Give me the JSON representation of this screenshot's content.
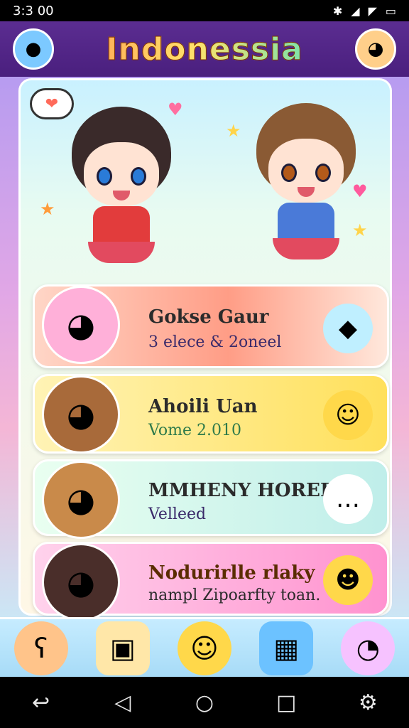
{
  "status_bar": {
    "time": "3:3 00",
    "icons": [
      "bluetooth-icon",
      "wifi-icon",
      "signal-icon",
      "battery-icon"
    ]
  },
  "header": {
    "title": "Indonessia",
    "left_avatar_icon": "blue-creature-avatar-icon",
    "right_avatar_icon": "cat-avatar-icon"
  },
  "hero": {
    "characters": [
      "girl-red-dress-icon",
      "girl-blue-dress-icon"
    ],
    "bubble_icon": "heart-speech-bubble-icon"
  },
  "cards": [
    {
      "title": "Gokse Gaur",
      "subtitle": "3 elece & 2oneel",
      "avatar_icon": "pink-hair-girl-icon",
      "action_icon": "blue-bird-mascot-icon",
      "colors": {
        "start": "#ffd6c7",
        "end": "#ff9d86"
      }
    },
    {
      "title": "Ahoili Uan",
      "subtitle": "Vome 2.010",
      "avatar_icon": "brown-hair-girl-icon",
      "action_icon": "yellow-cat-mascot-icon",
      "colors": {
        "start": "#fff3b5",
        "end": "#ffe05b"
      }
    },
    {
      "title": "MMHENY HORERI",
      "subtitle": "Velleed",
      "avatar_icon": "ponytail-girl-icon",
      "action_icon": "speech-bubble-icon",
      "colors": {
        "start": "#e9fff0",
        "end": "#bfeeea"
      }
    },
    {
      "title": "Nodurirlle rlaky",
      "subtitle": "nampl Zipoarfty toan.",
      "avatar_icon": "dark-hair-girl-icon",
      "action_icon": "yellow-blob-mascot-icon",
      "colors": {
        "start": "#ffd2ec",
        "end": "#ff92cf"
      }
    }
  ],
  "tab_bar": {
    "items": [
      {
        "icon": "bear-face-icon"
      },
      {
        "icon": "photo-bag-icon"
      },
      {
        "icon": "yellow-dog-icon"
      },
      {
        "icon": "tablet-apps-icon"
      },
      {
        "icon": "pink-bunny-icon"
      }
    ]
  },
  "nav_bar": {
    "items": [
      "back-gesture-icon",
      "back-triangle-icon",
      "home-circle-icon",
      "recents-square-icon",
      "settings-gear-icon"
    ]
  }
}
